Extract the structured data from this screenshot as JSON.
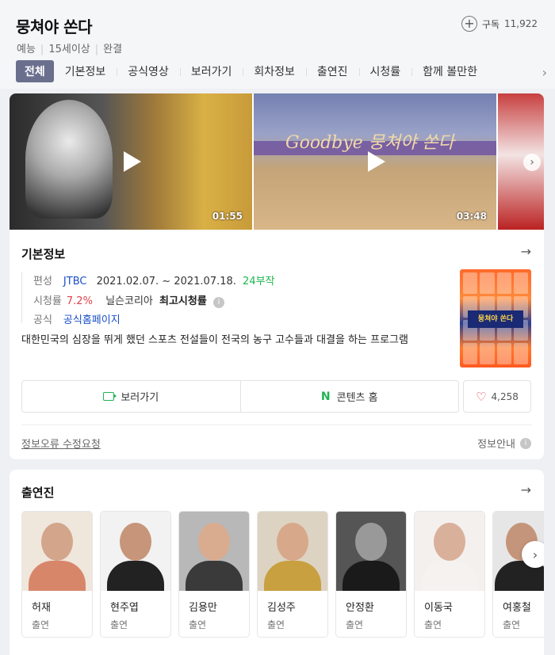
{
  "header": {
    "title": "뭉쳐야 쏜다",
    "meta": [
      "예능",
      "15세이상",
      "완결"
    ],
    "subscribe_label": "구독",
    "subscribe_count": "11,922"
  },
  "tabs": [
    "전체",
    "기본정보",
    "공식영상",
    "보러가기",
    "회차정보",
    "출연진",
    "시청률",
    "함께 볼만한"
  ],
  "videos": [
    {
      "duration": "01:55"
    },
    {
      "duration": "03:48",
      "overlay_text": "Goodbye 뭉쳐야 쏜다"
    }
  ],
  "basic_info": {
    "heading": "기본정보",
    "broadcast_label": "편성",
    "network": "JTBC",
    "period": "2021.02.07. ~ 2021.07.18.",
    "episodes": "24부작",
    "rating_label": "시청률",
    "rating_value": "7.2%",
    "rating_source": "닐슨코리아",
    "rating_note": "최고시청률",
    "official_label": "공식",
    "official_link": "공식홈페이지",
    "description": "대한민국의 심장을 뛰게 했던 스포츠 전설들이 전국의 농구 고수들과 대결을 하는 프로그램",
    "poster_logo": "뭉쳐야 쏜다"
  },
  "actions": {
    "watch": "보러가기",
    "content_home": "콘텐츠 홈",
    "content_home_icon": "N",
    "likes": "4,258"
  },
  "footer": {
    "report": "정보오류 수정요청",
    "guide": "정보안내"
  },
  "cast": {
    "heading": "출연진",
    "people": [
      {
        "name": "허재",
        "role": "출연"
      },
      {
        "name": "현주엽",
        "role": "출연"
      },
      {
        "name": "김용만",
        "role": "출연"
      },
      {
        "name": "김성주",
        "role": "출연"
      },
      {
        "name": "안정환",
        "role": "출연"
      },
      {
        "name": "이동국",
        "role": "출연"
      },
      {
        "name": "여홍철",
        "role": "출연"
      }
    ]
  },
  "colors": {
    "accent_green": "#1db54f",
    "link_blue": "#1a4fc9",
    "rating_red": "#e0424b",
    "active_tab": "#6b6f8e"
  }
}
